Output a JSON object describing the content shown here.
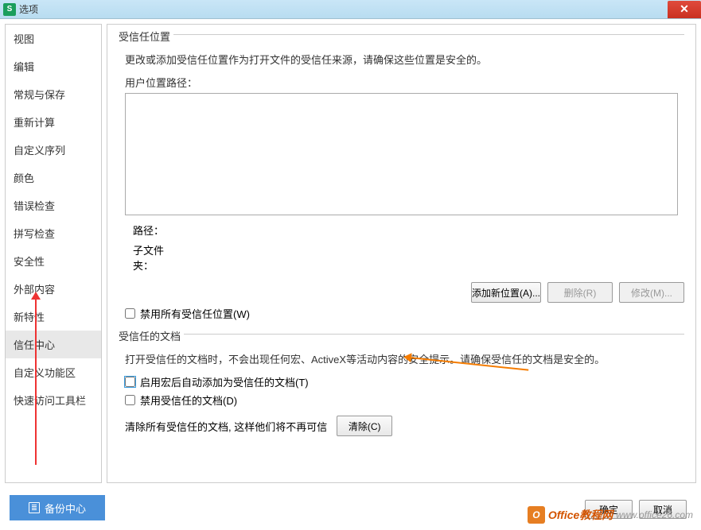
{
  "title": "选项",
  "sidebar": {
    "items": [
      "视图",
      "编辑",
      "常规与保存",
      "重新计算",
      "自定义序列",
      "颜色",
      "错误检查",
      "拼写检查",
      "安全性",
      "外部内容",
      "新特性",
      "信任中心",
      "自定义功能区",
      "快速访问工具栏"
    ],
    "selectedIndex": 11
  },
  "trustedLocations": {
    "legend": "受信任位置",
    "desc": "更改或添加受信任位置作为打开文件的受信任来源，请确保这些位置是安全的。",
    "userPathLabel": "用户位置路径：",
    "pathLabel": "路径：",
    "pathValue": "",
    "subfolderLabel": "子文件夹：",
    "subfolderValue": "",
    "addBtn": "添加新位置(A)...",
    "removeBtn": "删除(R)",
    "modifyBtn": "修改(M)...",
    "disableAll": "禁用所有受信任位置(W)"
  },
  "trustedDocs": {
    "legend": "受信任的文档",
    "desc": "打开受信任的文档时，不会出现任何宏、ActiveX等活动内容的安全提示。请确保受信任的文档是安全的。",
    "autoAdd": "启用宏后自动添加为受信任的文档(T)",
    "disable": "禁用受信任的文档(D)",
    "clearDesc": "清除所有受信任的文档, 这样他们将不再可信",
    "clearBtn": "清除(C)"
  },
  "footer": {
    "backup": "备份中心"
  },
  "dialog": {
    "ok": "确定",
    "cancel": "取消"
  },
  "watermark": {
    "brand": "Office教程网",
    "url": "www.office26.com"
  }
}
